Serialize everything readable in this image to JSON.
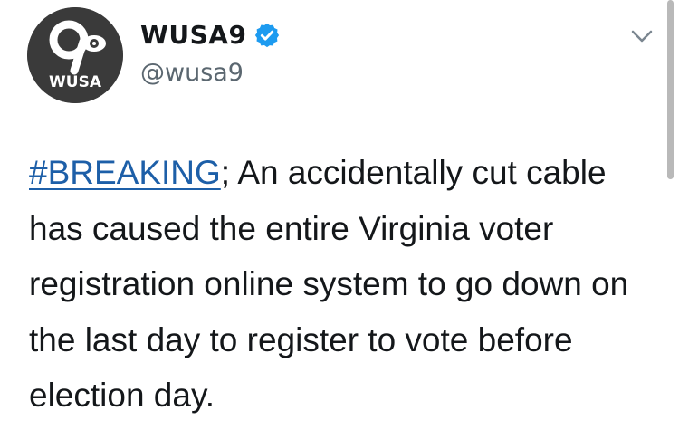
{
  "account": {
    "display_name": "WUSA9",
    "handle": "@wusa9",
    "verified": true,
    "avatar": {
      "logo_number": "9",
      "logo_text": "WUSA",
      "background_color": "#3a3a3a",
      "logo_color": "#ffffff"
    }
  },
  "menu": {
    "icon": "chevron-down-icon"
  },
  "tweet": {
    "hashtag": "#BREAKING",
    "text": "; An accidentally cut cable has caused the entire Virginia voter registration online system to go down on the last day to register to vote before election day."
  },
  "colors": {
    "hashtag": "#1d5fa8",
    "verified_badge": "#1d9bf0",
    "handle": "#5b6770",
    "text": "#14171a"
  }
}
